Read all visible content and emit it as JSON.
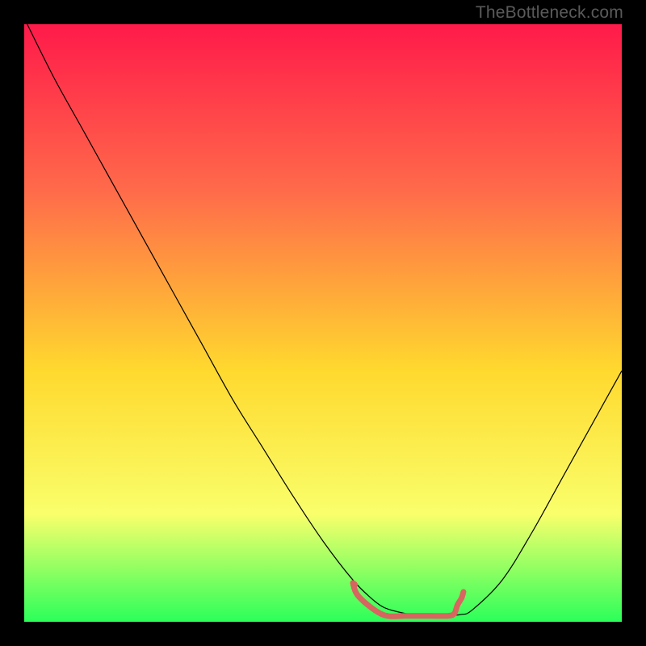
{
  "watermark": "TheBottleneck.com",
  "chart_data": {
    "type": "line",
    "title": "",
    "xlabel": "",
    "ylabel": "",
    "xlim": [
      0,
      100
    ],
    "ylim": [
      0,
      100
    ],
    "background_gradient": {
      "top": "#ff1a4a",
      "mid1": "#ff6b4a",
      "mid2": "#ffd92e",
      "mid3": "#f9ff6b",
      "bottom": "#2bff5a"
    },
    "series": [
      {
        "name": "bottleneck-curve",
        "color": "#000000",
        "width": 1.2,
        "x": [
          0.5,
          5,
          10,
          15,
          20,
          25,
          30,
          35,
          40,
          45,
          50,
          55,
          58,
          60,
          62,
          65,
          70,
          73,
          75,
          80,
          85,
          90,
          95,
          100
        ],
        "y": [
          100,
          91,
          82,
          73,
          64,
          55,
          46,
          37,
          29,
          21,
          13.5,
          7,
          4,
          2.5,
          1.8,
          1.2,
          1.0,
          1.2,
          2,
          7,
          15,
          24,
          33,
          42
        ]
      },
      {
        "name": "highlight-band",
        "color": "#d8655f",
        "width": 7,
        "x": [
          55,
          56,
          60,
          64,
          68,
          71,
          72,
          72.5,
          73.2,
          73.5
        ],
        "y": [
          6.5,
          4.2,
          1.2,
          1.0,
          1.0,
          1.0,
          1.4,
          2.8,
          4.0,
          5.0
        ]
      }
    ],
    "highlight_dot": {
      "x": 55.2,
      "y": 6.2,
      "r": 4.5,
      "color": "#d8655f"
    }
  }
}
